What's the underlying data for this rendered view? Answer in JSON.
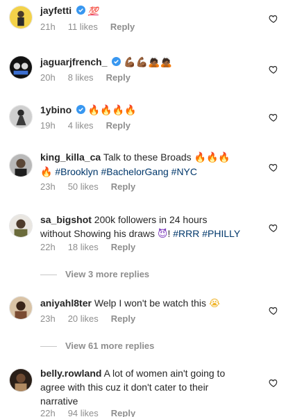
{
  "comments": [
    {
      "user": "jayfetti",
      "text": "",
      "emoji": "💯",
      "time": "21h",
      "likes": "11 likes",
      "reply": "Reply"
    },
    {
      "user": "jaguarjfrench_",
      "text": "",
      "emoji": "💪🏾💪🏾🙇🏾🙇🏾",
      "time": "20h",
      "likes": "8 likes",
      "reply": "Reply"
    },
    {
      "user": "1ybino",
      "text": "",
      "emoji": "🔥🔥🔥🔥",
      "time": "19h",
      "likes": "4 likes",
      "reply": "Reply"
    },
    {
      "user": "king_killa_ca",
      "text": "Talk to these Broads",
      "emoji": "🔥🔥🔥",
      "emoji2": "🔥",
      "tags": "#Brooklyn #BachelorGang #NYC",
      "time": "23h",
      "likes": "50 likes",
      "reply": "Reply"
    },
    {
      "user": "sa_bigshot",
      "text": "200k followers in 24 hours",
      "text2": "without Showing his draws",
      "emoji": "😈",
      "text3": "!",
      "tags": "#RRR #PHILLY",
      "time": "22h",
      "likes": "18 likes",
      "reply": "Reply"
    },
    {
      "user": "aniyahl8ter",
      "text": "Welp I won't be watch this",
      "emoji": "😭",
      "time": "23h",
      "likes": "20 likes",
      "reply": "Reply"
    },
    {
      "user": "belly.rowland",
      "text": "A lot of women ain't going to",
      "text2": "agree with this cuz it don't cater to their",
      "text3": "narrative",
      "time": "22h",
      "likes": "94 likes",
      "reply": "Reply"
    }
  ],
  "view_more_1": "View 3 more replies",
  "view_more_2": "View 61 more replies"
}
